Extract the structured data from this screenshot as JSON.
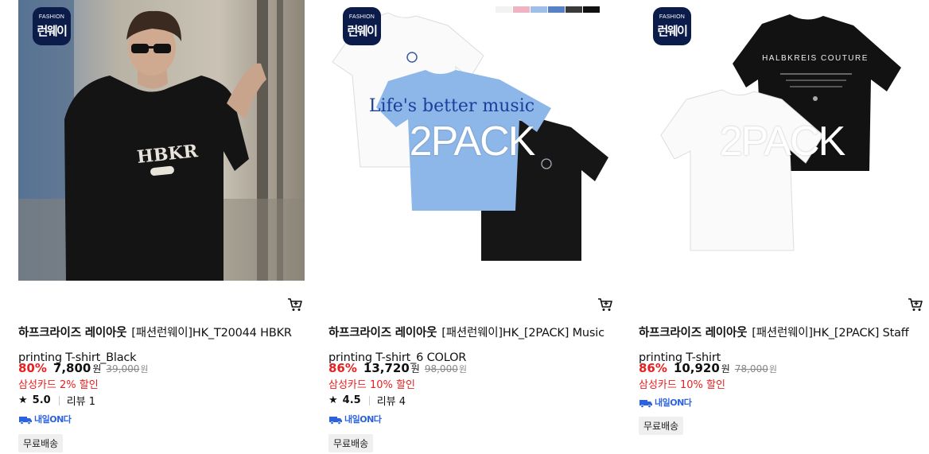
{
  "products": [
    {
      "badge": {
        "line1": "FASHION",
        "line2": "런웨이"
      },
      "overlay": "",
      "brand": "하프크라이즈 레이아웃",
      "name": "[패션런웨이]HK_T20044 HBKR printing T-shirt_Black",
      "discount_rate": "80%",
      "price": "7,800",
      "currency": "원",
      "original_price": "39,000",
      "card_discount": "삼성카드 2% 할인",
      "rating": "5.0",
      "review_label": "리뷰 1",
      "delivery_label": "내일ON다",
      "tag": "무료배송",
      "image_text": "HBKR"
    },
    {
      "badge": {
        "line1": "FASHION",
        "line2": "런웨이"
      },
      "overlay": "2PACK",
      "brand": "하프크라이즈 레이아웃",
      "name": "[패션런웨이]HK_[2PACK] Music printing T-shirt_6 COLOR",
      "discount_rate": "86%",
      "price": "13,720",
      "currency": "원",
      "original_price": "98,000",
      "card_discount": "삼성카드 10% 할인",
      "rating": "4.5",
      "review_label": "리뷰 4",
      "delivery_label": "내일ON다",
      "tag": "무료배송",
      "image_text": "Life's better music",
      "swatches": [
        "#f2f2f2",
        "#f0b3c4",
        "#9ebfe8",
        "#5880c4",
        "#3a3a3a",
        "#111111"
      ]
    },
    {
      "badge": {
        "line1": "FASHION",
        "line2": "런웨이"
      },
      "overlay": "2PACK",
      "brand": "하프크라이즈 레이아웃",
      "name": "[패션런웨이]HK_[2PACK] Staff printing T-shirt",
      "discount_rate": "86%",
      "price": "10,920",
      "currency": "원",
      "original_price": "78,000",
      "card_discount": "삼성카드 10% 할인",
      "delivery_label": "내일ON다",
      "tag": "무료배송",
      "image_text": "HALBKREIS COUTURE"
    }
  ],
  "colors": {
    "accent_red": "#e8201f",
    "delivery_blue": "#2a62e0",
    "badge_navy": "#0c1c4a"
  }
}
